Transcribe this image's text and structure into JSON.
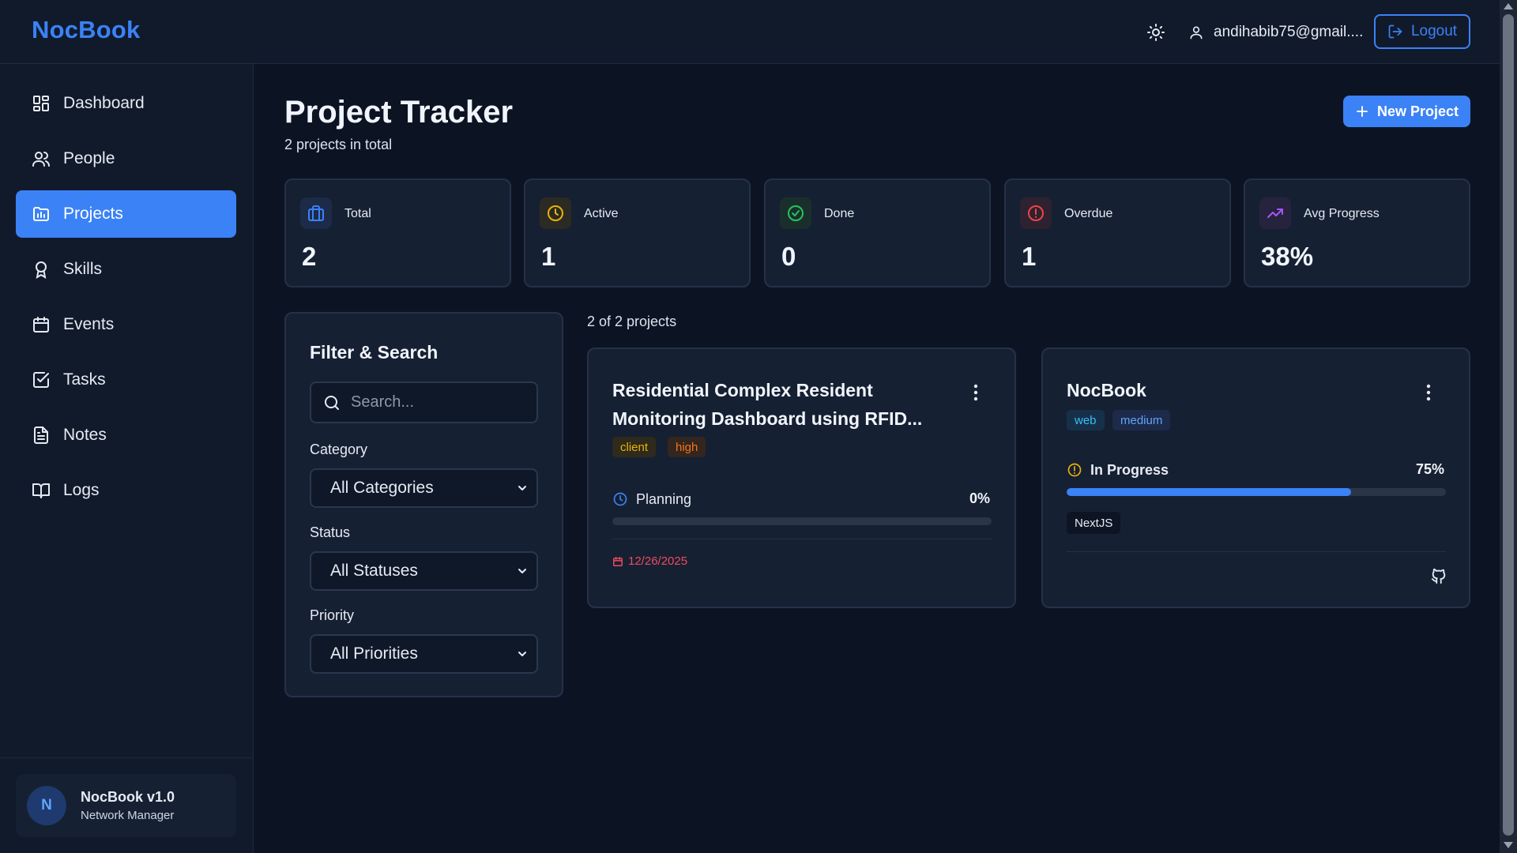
{
  "header": {
    "brand": "NocBook",
    "user_email": "andihabib75@gmail....",
    "logout_label": "Logout"
  },
  "sidebar": {
    "items": [
      {
        "label": "Dashboard",
        "icon": "dashboard-icon"
      },
      {
        "label": "People",
        "icon": "people-icon"
      },
      {
        "label": "Projects",
        "icon": "projects-icon",
        "active": true
      },
      {
        "label": "Skills",
        "icon": "award-icon"
      },
      {
        "label": "Events",
        "icon": "calendar-icon"
      },
      {
        "label": "Tasks",
        "icon": "checkbox-icon"
      },
      {
        "label": "Notes",
        "icon": "document-icon"
      },
      {
        "label": "Logs",
        "icon": "book-icon"
      }
    ],
    "footer": {
      "avatar_letter": "N",
      "title": "NocBook v1.0",
      "subtitle": "Network Manager"
    }
  },
  "page": {
    "title": "Project Tracker",
    "subtitle": "2 projects in total",
    "new_project_label": "New Project"
  },
  "stats": [
    {
      "label": "Total",
      "value": "2",
      "icon": "briefcase-icon",
      "color": "#3b82f6"
    },
    {
      "label": "Active",
      "value": "1",
      "icon": "clock-icon",
      "color": "#eab308"
    },
    {
      "label": "Done",
      "value": "0",
      "icon": "check-circle-icon",
      "color": "#22c55e"
    },
    {
      "label": "Overdue",
      "value": "1",
      "icon": "alert-circle-icon",
      "color": "#ef4444"
    },
    {
      "label": "Avg Progress",
      "value": "38%",
      "icon": "trending-up-icon",
      "color": "#a855f7"
    }
  ],
  "filter": {
    "title": "Filter & Search",
    "search_placeholder": "Search...",
    "category_label": "Category",
    "category_value": "All Categories",
    "status_label": "Status",
    "status_value": "All Statuses",
    "priority_label": "Priority",
    "priority_value": "All Priorities"
  },
  "projects_count": "2 of 2 projects",
  "projects": [
    {
      "title": "Residential Complex Resident Monitoring Dashboard using RFID...",
      "tags": [
        "client",
        "high"
      ],
      "status": "Planning",
      "progress_label": "0%",
      "progress": 0,
      "due_date": "12/26/2025"
    },
    {
      "title": "NocBook",
      "tags": [
        "web",
        "medium"
      ],
      "status": "In Progress",
      "progress_label": "75%",
      "progress": 0.75,
      "tech": [
        "NextJS"
      ]
    }
  ],
  "colors": {
    "accent": "#3b82f6",
    "background": "#0c1424",
    "panel": "#162033",
    "danger": "#ef4b5c"
  }
}
